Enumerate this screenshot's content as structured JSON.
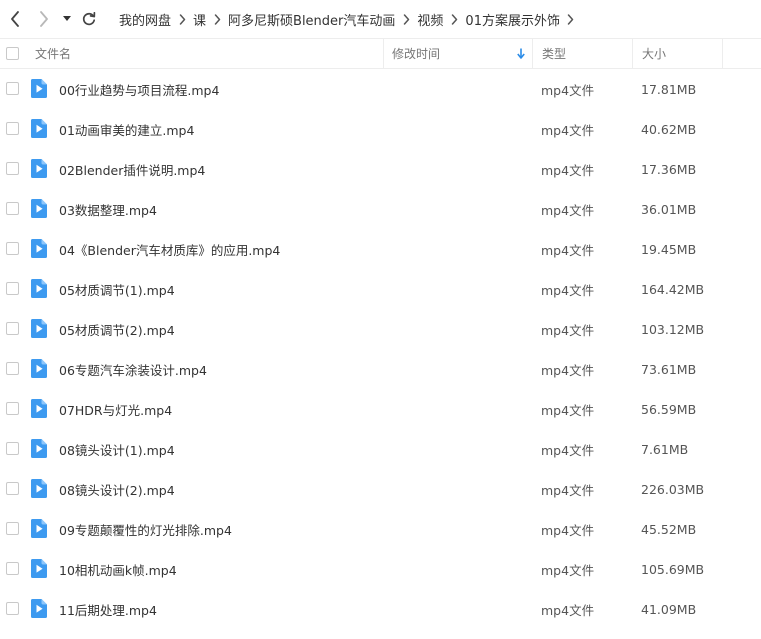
{
  "nav": {
    "breadcrumb": [
      "我的网盘",
      "课",
      "阿多尼斯硕Blender汽车动画",
      "视频",
      "01方案展示外饰"
    ]
  },
  "columns": {
    "name": "文件名",
    "time": "修改时间",
    "type": "类型",
    "size": "大小",
    "sort_column": "time",
    "sort_direction": "descending"
  },
  "accent_color": "#2b8ce8",
  "files": [
    {
      "name": "00行业趋势与项目流程.mp4",
      "type": "mp4文件",
      "size": "17.81MB"
    },
    {
      "name": "01动画审美的建立.mp4",
      "type": "mp4文件",
      "size": "40.62MB"
    },
    {
      "name": "02Blender插件说明.mp4",
      "type": "mp4文件",
      "size": "17.36MB"
    },
    {
      "name": "03数据整理.mp4",
      "type": "mp4文件",
      "size": "36.01MB"
    },
    {
      "name": "04《Blender汽车材质库》的应用.mp4",
      "type": "mp4文件",
      "size": "19.45MB"
    },
    {
      "name": "05材质调节(1).mp4",
      "type": "mp4文件",
      "size": "164.42MB"
    },
    {
      "name": "05材质调节(2).mp4",
      "type": "mp4文件",
      "size": "103.12MB"
    },
    {
      "name": "06专题汽车涂装设计.mp4",
      "type": "mp4文件",
      "size": "73.61MB"
    },
    {
      "name": "07HDR与灯光.mp4",
      "type": "mp4文件",
      "size": "56.59MB"
    },
    {
      "name": "08镜头设计(1).mp4",
      "type": "mp4文件",
      "size": "7.61MB"
    },
    {
      "name": "08镜头设计(2).mp4",
      "type": "mp4文件",
      "size": "226.03MB"
    },
    {
      "name": "09专题颠覆性的灯光排除.mp4",
      "type": "mp4文件",
      "size": "45.52MB"
    },
    {
      "name": "10相机动画k帧.mp4",
      "type": "mp4文件",
      "size": "105.69MB"
    },
    {
      "name": "11后期处理.mp4",
      "type": "mp4文件",
      "size": "41.09MB"
    }
  ]
}
